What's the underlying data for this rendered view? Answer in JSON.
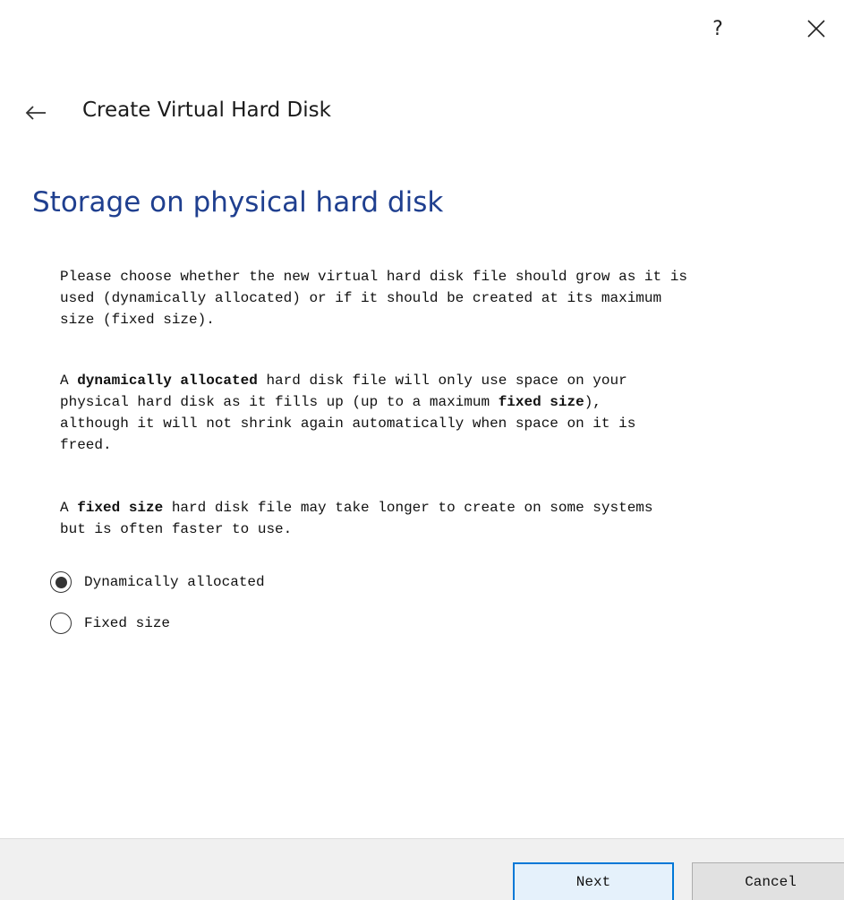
{
  "title_bar": {
    "help_label": "?",
    "help_icon": "question-mark-icon",
    "close_icon": "close-icon"
  },
  "header": {
    "back_icon": "back-arrow-icon",
    "wizard_title": "Create Virtual Hard Disk"
  },
  "page": {
    "heading": "Storage on physical hard disk",
    "heading_color": "#1f3f8f",
    "paragraph1": "Please choose whether the new virtual hard disk file should grow as it is\nused (dynamically allocated) or if it should be created at its maximum\nsize (fixed size).",
    "paragraph2": {
      "part1": "A ",
      "bold1": "dynamically allocated",
      "part2": " hard disk file will only use space on your\nphysical hard disk as it fills up (up to a maximum ",
      "bold2": "fixed size",
      "part3": "),\nalthough it will not shrink again automatically when space on it is\nfreed."
    },
    "paragraph3": {
      "part1": "A ",
      "bold1": "fixed size",
      "part2": " hard disk file may take longer to create on some systems\nbut is often faster to use."
    }
  },
  "options": {
    "dynamically_allocated": {
      "label": "Dynamically allocated",
      "selected": true
    },
    "fixed_size": {
      "label": "Fixed size",
      "selected": false
    }
  },
  "footer": {
    "next_label": "Next",
    "cancel_label": "Cancel",
    "accent_color": "#0078d7"
  }
}
